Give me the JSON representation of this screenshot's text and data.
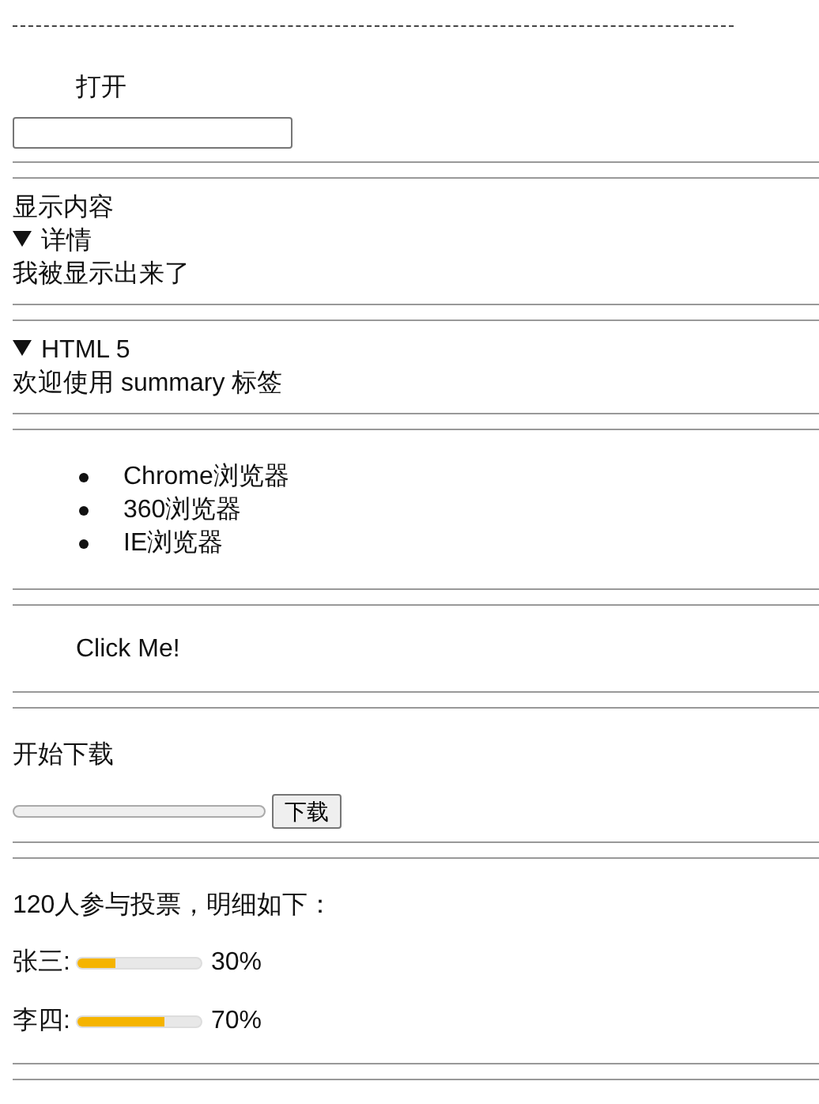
{
  "open_label": "打开",
  "details": [
    {
      "heading": "显示内容",
      "summary": "详情",
      "expanded": true,
      "content": "我被显示出来了"
    },
    {
      "summary": "HTML 5",
      "expanded": true,
      "content": "欢迎使用 summary 标签"
    }
  ],
  "browser_list": [
    "Chrome浏览器",
    "360浏览器",
    "IE浏览器"
  ],
  "click_text": "Click Me!",
  "download": {
    "label": "开始下载",
    "level": 0,
    "button": "下载"
  },
  "vote": {
    "summary": "120人参与投票，明细如下：",
    "candidates": [
      {
        "name": "张三:",
        "level": 0.3,
        "reading": "30%"
      },
      {
        "name": "李四:",
        "level": 0.7,
        "reading": "70%"
      }
    ]
  }
}
